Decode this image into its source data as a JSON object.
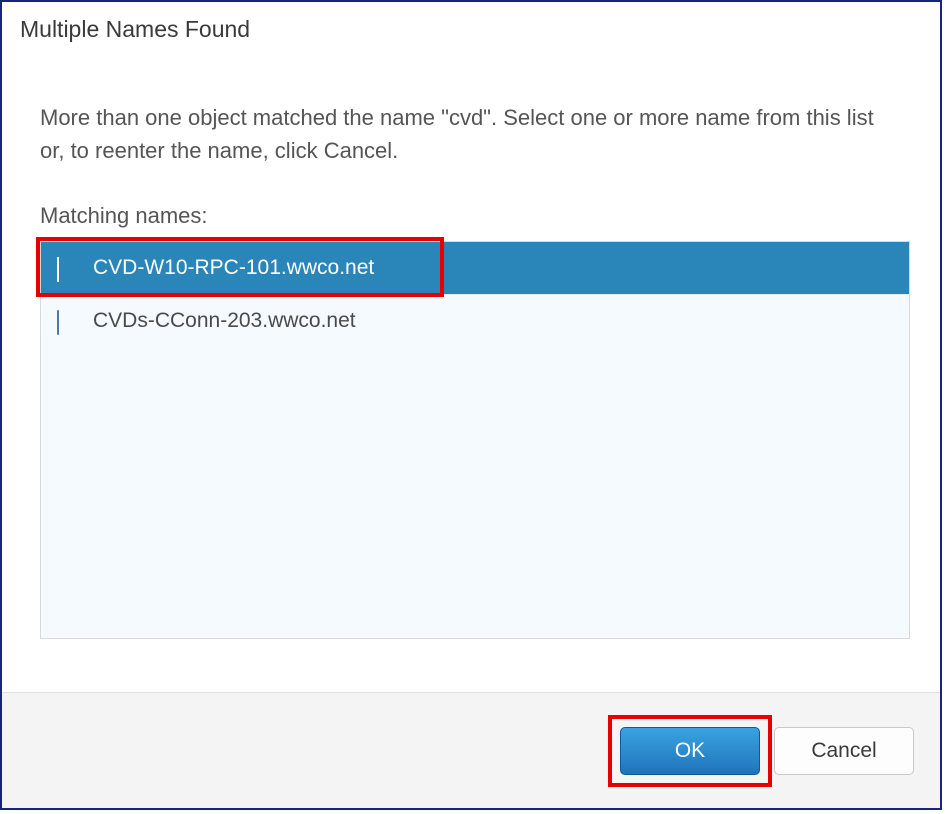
{
  "dialog": {
    "title": "Multiple Names Found",
    "instruction": "More than one object matched the name \"cvd\". Select one or more name from this list or, to reenter the name, click Cancel.",
    "matching_label": "Matching names:"
  },
  "list": {
    "items": [
      {
        "name": "CVD-W10-RPC-101.wwco.net",
        "selected": true
      },
      {
        "name": "CVDs-CConn-203.wwco.net",
        "selected": false
      }
    ]
  },
  "buttons": {
    "ok": "OK",
    "cancel": "Cancel"
  }
}
